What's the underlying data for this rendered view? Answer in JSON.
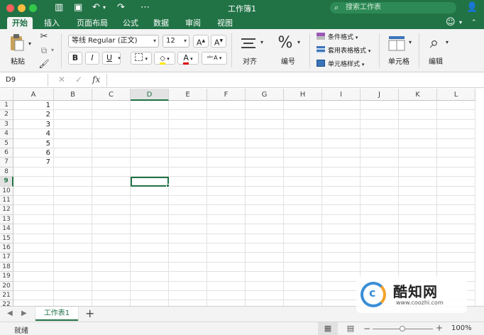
{
  "window": {
    "title": "工作簿1",
    "search_placeholder": "搜索工作表"
  },
  "tabs": [
    "开始",
    "插入",
    "页面布局",
    "公式",
    "数据",
    "审阅",
    "视图"
  ],
  "ribbon": {
    "paste_label": "粘贴",
    "font_name": "等线 Regular (正文)",
    "font_size": "12",
    "bold": "B",
    "italic": "I",
    "underline": "U",
    "align_label": "对齐",
    "number_label": "编号",
    "conditional_format": "条件格式",
    "format_as_table": "套用表格格式",
    "cell_styles": "单元格样式",
    "cells_label": "单元格",
    "edit_label": "编辑"
  },
  "formula_bar": {
    "name_box": "D9",
    "fx": "fx",
    "value": ""
  },
  "columns": [
    "A",
    "B",
    "C",
    "D",
    "E",
    "F",
    "G",
    "H",
    "I",
    "J",
    "K",
    "L"
  ],
  "rows": [
    "1",
    "2",
    "3",
    "4",
    "5",
    "6",
    "7",
    "8",
    "9",
    "10",
    "11",
    "12",
    "13",
    "14",
    "15",
    "16",
    "17",
    "18",
    "19",
    "20",
    "21",
    "22"
  ],
  "cells": {
    "A1": "1",
    "A2": "2",
    "A3": "3",
    "A4": "4",
    "A5": "5",
    "A6": "6",
    "A7": "7"
  },
  "selected_cell": "D9",
  "sheets": [
    "工作表1"
  ],
  "status": {
    "ready": "就绪",
    "zoom": "100%"
  },
  "watermark": {
    "name": "酷知网",
    "url": "www.coozhi.com"
  },
  "colors": {
    "accent": "#217346",
    "selection": "#217346"
  }
}
